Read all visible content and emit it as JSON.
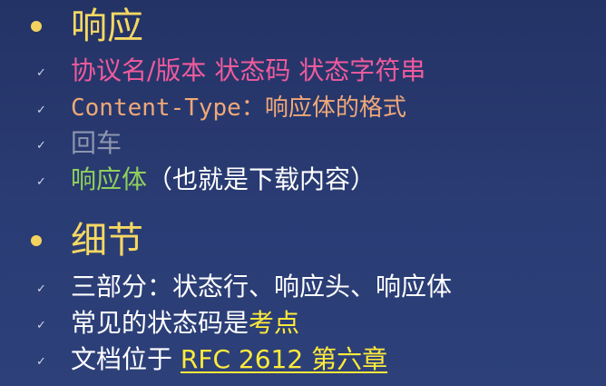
{
  "sections": [
    {
      "heading": "响应",
      "items": [
        {
          "text": "协议名/版本 状态码 状态字符串"
        },
        {
          "text": "Content-Type：响应体的格式"
        },
        {
          "text": "回车"
        },
        {
          "prefix": "响应体",
          "suffix": "（也就是下载内容）"
        }
      ]
    },
    {
      "heading": "细节",
      "items": [
        {
          "text": "三部分：状态行、响应头、响应体"
        },
        {
          "prefix": "常见的状态码是",
          "highlight": "考点"
        },
        {
          "prefix": "文档位于 ",
          "link": "RFC 2612 第六章"
        }
      ]
    }
  ],
  "check_glyph": "✓",
  "colors": {
    "background": "#27386f",
    "heading": "#f5d863",
    "pink": "#ef5b9c",
    "salmon": "#f0a878",
    "gray": "#8d96ae",
    "green": "#8fd05a",
    "highlight": "#ffeb3b"
  }
}
